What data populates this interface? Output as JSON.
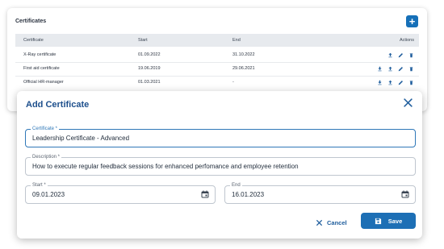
{
  "table": {
    "title": "Certificates",
    "headers": {
      "certificate": "Certificate",
      "start": "Start",
      "end": "End",
      "actions": "Actions"
    },
    "rows": [
      {
        "certificate": "X-Ray certificate",
        "start": "01.09.2022",
        "end": "31.10.2022",
        "download": false
      },
      {
        "certificate": "First aid certificate",
        "start": "19.06.2019",
        "end": "29.06.2021",
        "download": true
      },
      {
        "certificate": "Official HR-manager",
        "start": "01.03.2021",
        "end": "-",
        "download": true
      }
    ]
  },
  "modal": {
    "title": "Add Certificate",
    "certificate": {
      "label": "Certificate *",
      "value": "Leadership Certificate - Advanced"
    },
    "description": {
      "label": "Description *",
      "value": "How to execute regular feedback sessions for enhanced perfomance and employee retention"
    },
    "start": {
      "label": "Start *",
      "value": "09.01.2023"
    },
    "end": {
      "label": "End",
      "value": "16.01.2023"
    },
    "cancel_label": "Cancel",
    "save_label": "Save"
  },
  "colors": {
    "accent": "#1670b8",
    "title": "#1d4f8c",
    "focus": "#2f78b8"
  }
}
